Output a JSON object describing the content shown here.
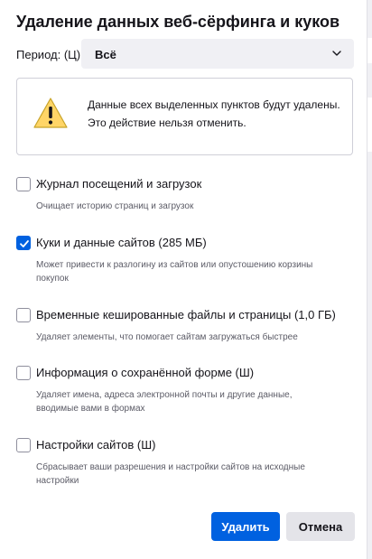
{
  "dialog": {
    "title": "Удаление данных веб-сёрфинга и куков"
  },
  "period": {
    "label": "Период: (Ц)",
    "selected": "Всё"
  },
  "warning": {
    "line1": "Данные всех выделенных пунктов будут удалены.",
    "line2": "Это действие нельзя отменить."
  },
  "options": [
    {
      "label": "Журнал посещений и загрузок",
      "description": "Очищает историю страниц и загрузок",
      "checked": false
    },
    {
      "label": "Куки и данные сайтов (285 МБ)",
      "description": "Может привести к разлогину из сайтов или опустошению корзины покупок",
      "checked": true
    },
    {
      "label": "Временные кешированные файлы и страницы (1,0 ГБ)",
      "description": "Удаляет элементы, что помогает сайтам загружаться быстрее",
      "checked": false
    },
    {
      "label": "Информация о сохранённой форме (Ш)",
      "description": "Удаляет имена, адреса электронной почты и другие данные, вводимые вами в формах",
      "checked": false
    },
    {
      "label": "Настройки сайтов (Ш)",
      "description": "Сбрасывает ваши разрешения и настройки сайтов на исходные настройки",
      "checked": false
    }
  ],
  "buttons": {
    "confirm": "Удалить",
    "cancel": "Отмена"
  },
  "colors": {
    "accent": "#0061e0",
    "secondary_button": "#e4e4e9",
    "warning_icon": "#ffd567"
  },
  "icons": {
    "select_chevron": "chevron-down-icon",
    "warning": "warning-triangle-icon",
    "checked_mark": "checkmark-icon"
  }
}
